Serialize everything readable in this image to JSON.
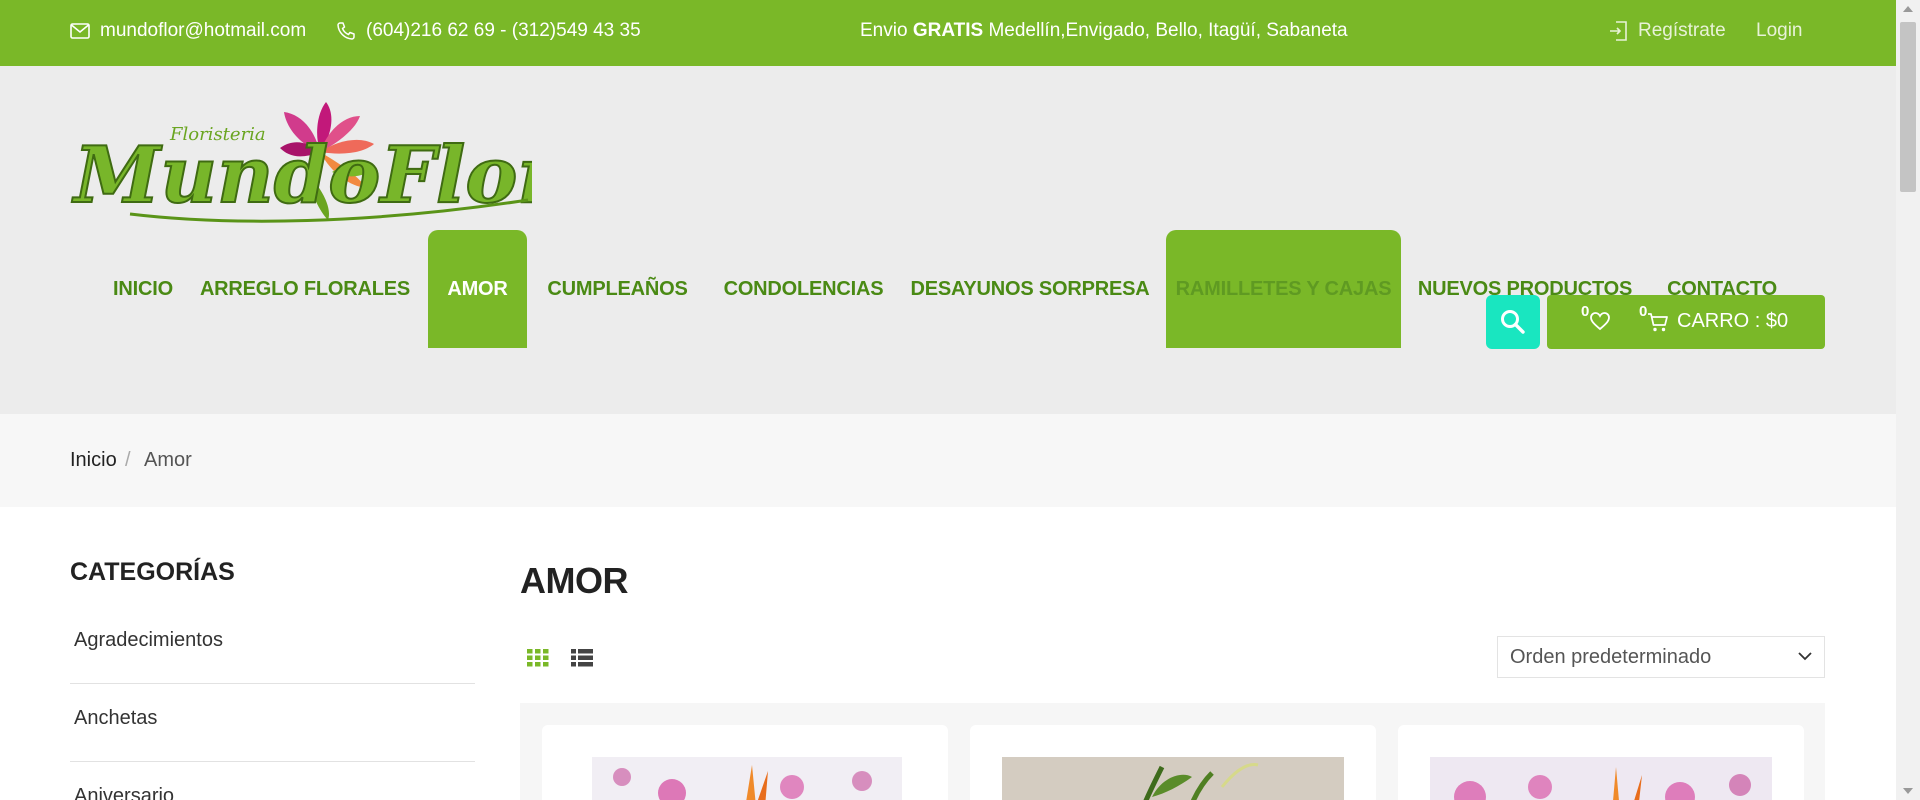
{
  "topbar": {
    "email": "mundoflor@hotmail.com",
    "phone": "(604)216 62 69 - (312)549 43 35",
    "promo_prefix": "Envio ",
    "promo_bold": "GRATIS",
    "promo_rest": " Medellín,Envigado, Bello, Itagüí, Sabaneta",
    "register": "Regístrate",
    "login": "Login"
  },
  "logo": {
    "top_text": "Floristeria",
    "main_text": "MundoFlor"
  },
  "nav": {
    "items": [
      {
        "label": "INICIO"
      },
      {
        "label": "ARREGLO FLORALES"
      },
      {
        "label": "AMOR"
      },
      {
        "label": "CUMPLEAÑOS"
      },
      {
        "label": "CONDOLENCIAS"
      },
      {
        "label": "DESAYUNOS SORPRESA"
      },
      {
        "label": "RAMILLETES Y CAJAS"
      },
      {
        "label": "NUEVOS PRODUCTOS"
      },
      {
        "label": "CONTACTO"
      }
    ]
  },
  "cart": {
    "wishlist_count": "0",
    "cart_count": "0",
    "label": "CARRO : $0"
  },
  "breadcrumb": {
    "home": "Inicio",
    "separator": "/",
    "current": "Amor"
  },
  "sidebar": {
    "title": "CATEGORÍAS",
    "items": [
      {
        "label": "Agradecimientos"
      },
      {
        "label": "Anchetas"
      },
      {
        "label": "Aniversario"
      }
    ]
  },
  "main": {
    "title": "AMOR",
    "sort_selected": "Orden predeterminado"
  },
  "colors": {
    "brand_green": "#7ab828",
    "nav_text": "#4a8a14",
    "search_accent": "#19e6c0"
  }
}
